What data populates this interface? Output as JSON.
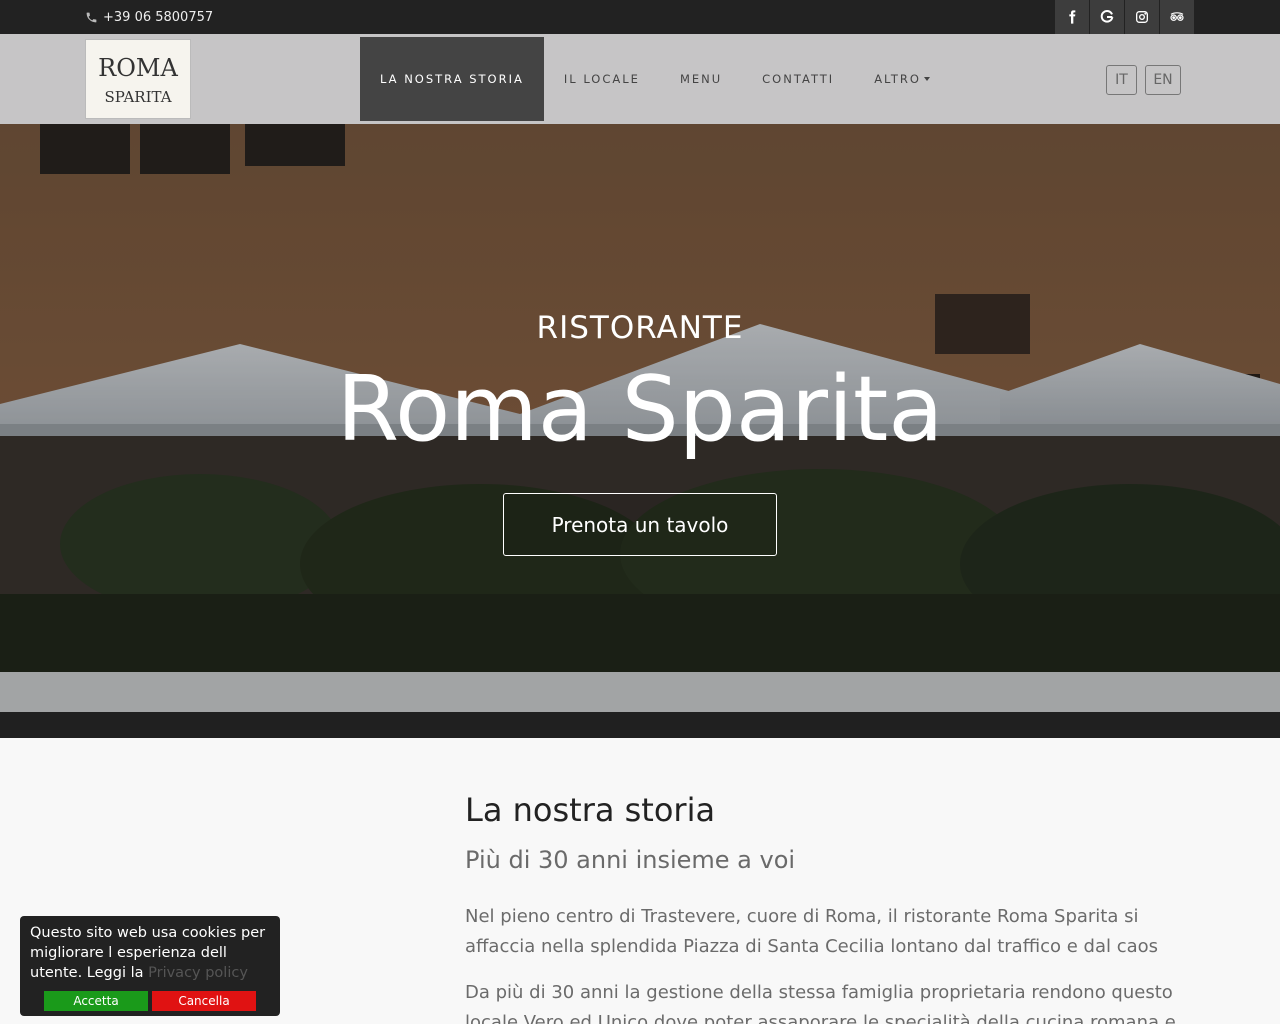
{
  "topbar": {
    "phone": "+39 06 5800757",
    "social": [
      {
        "icon": "facebook-icon"
      },
      {
        "icon": "google-icon"
      },
      {
        "icon": "instagram-icon"
      },
      {
        "icon": "tripadvisor-icon"
      }
    ]
  },
  "logo": {
    "line1": "ROMA",
    "line2": "SPARITA"
  },
  "nav": {
    "items": [
      {
        "label": "LA NOSTRA STORIA",
        "active": true
      },
      {
        "label": "IL LOCALE"
      },
      {
        "label": "MENU"
      },
      {
        "label": "CONTATTI"
      },
      {
        "label": "ALTRO"
      }
    ],
    "langs": [
      "IT",
      "EN"
    ]
  },
  "hero": {
    "subtitle": "RISTORANTE",
    "title": "Roma Sparita",
    "cta": "Prenota un tavolo"
  },
  "story": {
    "title": "La nostra storia",
    "subtitle": "Più di 30 anni insieme a voi",
    "p1": "Nel pieno centro di Trastevere, cuore di Roma, il ristorante Roma Sparita si affaccia nella splendida Piazza di Santa Cecilia lontano dal traffico e dal caos",
    "p2": "Da più di 30 anni la gestione della stessa famiglia proprietaria rendono questo locale Vero ed Unico dove poter assaporare le specialità della cucina romana e"
  },
  "cookie": {
    "text": "Questo sito web usa cookies per migliorare l esperienza dell utente. Leggi la",
    "link": "Privacy policy",
    "accept": "Accetta",
    "cancel": "Cancella"
  },
  "colors": {
    "topbar": "#222222",
    "navbar": "#c6c5c6",
    "nav_active": "#444444",
    "accept": "#1a9a1a",
    "cancel": "#e01212"
  }
}
